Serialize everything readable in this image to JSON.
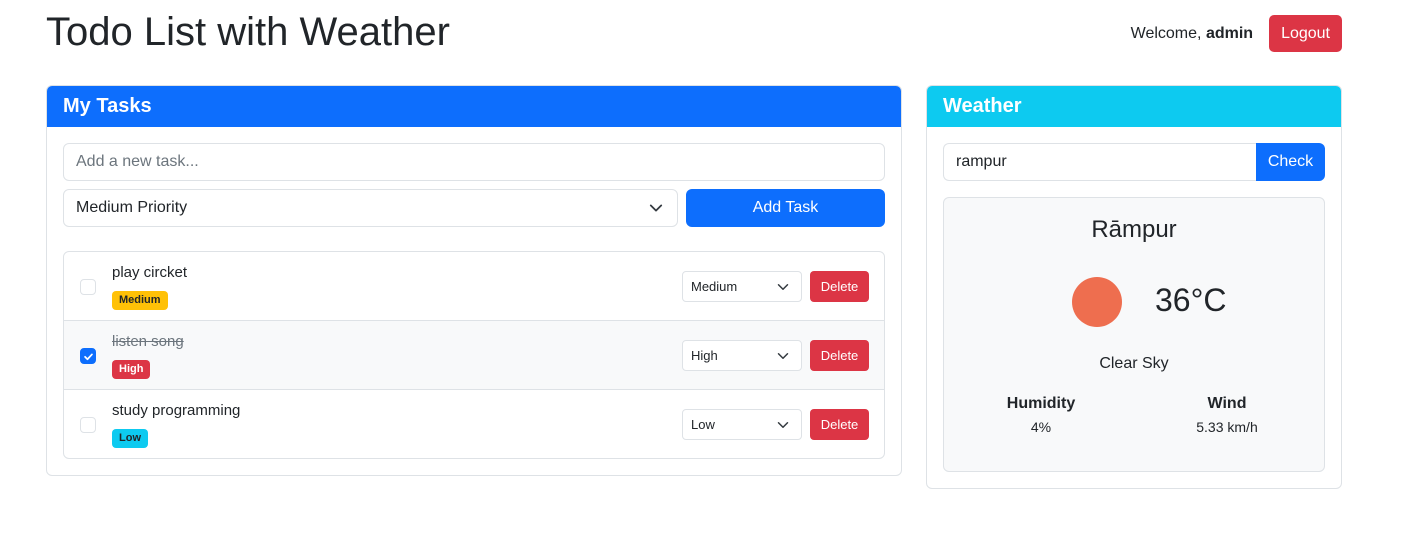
{
  "header": {
    "title": "Todo List with Weather",
    "welcome_prefix": "Welcome,",
    "username": "admin",
    "logout_label": "Logout"
  },
  "tasks": {
    "title": "My Tasks",
    "new_task_placeholder": "Add a new task...",
    "priority_selected": "Medium Priority",
    "add_button": "Add Task",
    "items": [
      {
        "title": "play circket",
        "completed": false,
        "badge": "Medium",
        "priority": "Medium",
        "delete_label": "Delete"
      },
      {
        "title": "listen song",
        "completed": true,
        "badge": "High",
        "priority": "High",
        "delete_label": "Delete"
      },
      {
        "title": "study programming",
        "completed": false,
        "badge": "Low",
        "priority": "Low",
        "delete_label": "Delete"
      }
    ]
  },
  "weather": {
    "title": "Weather",
    "city_input": "rampur",
    "check_button": "Check",
    "city": "Rāmpur",
    "temperature": "36°C",
    "condition": "Clear Sky",
    "humidity_label": "Humidity",
    "humidity_value": "4%",
    "wind_label": "Wind",
    "wind_value": "5.33 km/h"
  },
  "colors": {
    "primary": "#0d6efd",
    "danger": "#dc3545",
    "info": "#0dcaf0",
    "warning": "#ffc107",
    "weather_icon": "#ee6e4f"
  },
  "icons": {
    "dropdown": "chevron-down-icon",
    "checkbox": "check-icon",
    "weather": "sun-icon"
  }
}
